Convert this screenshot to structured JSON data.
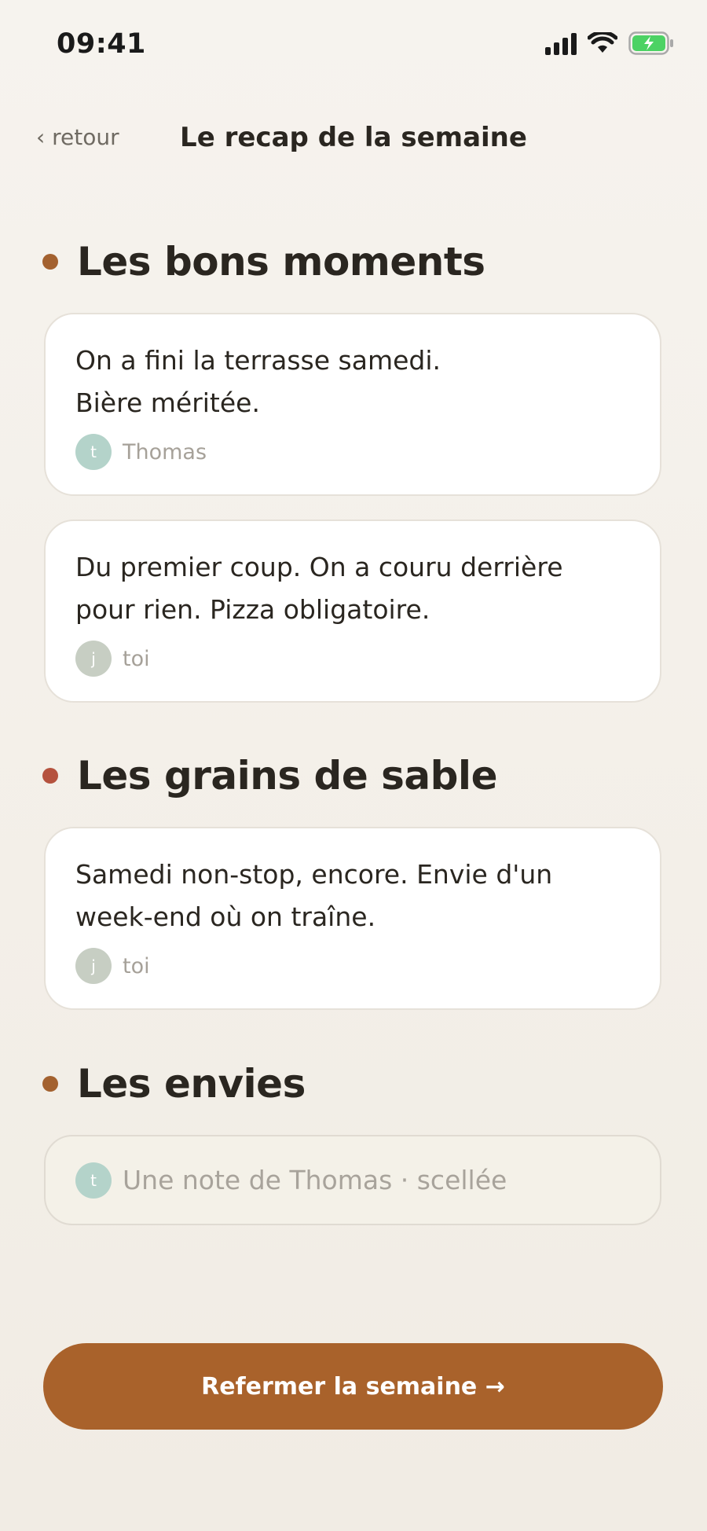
{
  "status": {
    "time": "09:41"
  },
  "nav": {
    "back_label": "‹ retour",
    "title": "Le recap de la semaine"
  },
  "sections": [
    {
      "title": "Les bons moments",
      "dot_color": "#a3612f",
      "cards": [
        {
          "text": "On a fini la terrasse samedi.\nBière méritée.",
          "avatar_initial": "t",
          "avatar_color": "#b4d3ca",
          "author": "Thomas"
        },
        {
          "text": "Du premier coup. On a couru derrière\npour rien. Pizza obligatoire.",
          "avatar_initial": "j",
          "avatar_color": "#c7cec3",
          "author": "toi"
        }
      ]
    },
    {
      "title": "Les grains de sable",
      "dot_color": "#b5523e",
      "cards": [
        {
          "text": "Samedi non-stop, encore. Envie d'un\nweek-end où on traîne.",
          "avatar_initial": "j",
          "avatar_color": "#c7cec3",
          "author": "toi"
        }
      ]
    },
    {
      "title": "Les envies",
      "dot_color": "#a3612f",
      "sealed": {
        "avatar_initial": "t",
        "avatar_color": "#b4d3ca",
        "text": "Une note de Thomas · scellée"
      }
    }
  ],
  "cta": {
    "label": "Refermer la semaine →",
    "color": "#a9622b"
  }
}
